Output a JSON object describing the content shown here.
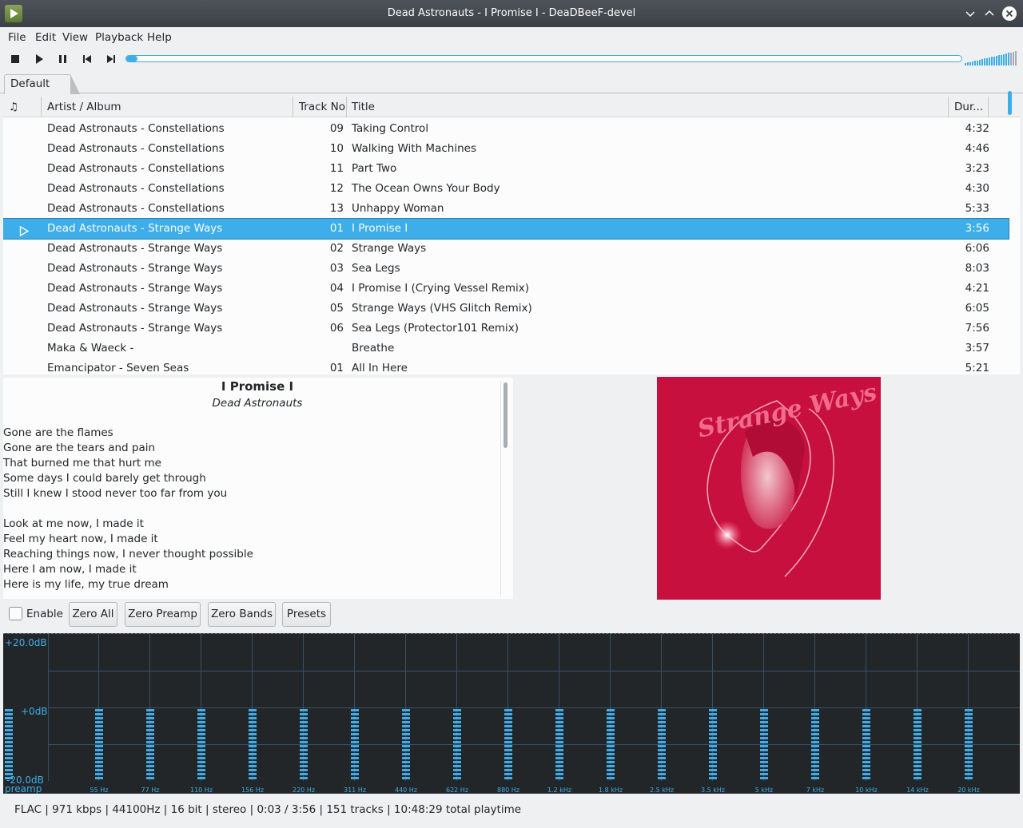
{
  "window": {
    "title": "Dead Astronauts - I Promise I - DeaDBeeF-devel"
  },
  "menu": [
    "File",
    "Edit",
    "View",
    "Playback",
    "Help"
  ],
  "toolbar": {
    "buttons": [
      "stop-icon",
      "play-icon",
      "pause-icon",
      "previous-icon",
      "next-icon"
    ],
    "seek_progress": 0.013,
    "volume_level": 0.85
  },
  "tabs": [
    "Default"
  ],
  "playlist": {
    "columns": [
      "♫",
      "Artist / Album",
      "Track No",
      "Title",
      "Dur..."
    ],
    "rows": [
      {
        "artist": "Dead Astronauts - Constellations",
        "no": "09",
        "title": "Taking Control",
        "dur": "4:32"
      },
      {
        "artist": "Dead Astronauts - Constellations",
        "no": "10",
        "title": "Walking With Machines",
        "dur": "4:46"
      },
      {
        "artist": "Dead Astronauts - Constellations",
        "no": "11",
        "title": "Part Two",
        "dur": "3:23"
      },
      {
        "artist": "Dead Astronauts - Constellations",
        "no": "12",
        "title": "The Ocean Owns Your Body",
        "dur": "4:30"
      },
      {
        "artist": "Dead Astronauts - Constellations",
        "no": "13",
        "title": "Unhappy Woman",
        "dur": "5:33"
      },
      {
        "artist": "Dead Astronauts - Strange Ways",
        "no": "01",
        "title": "I Promise I",
        "dur": "3:56",
        "playing": true
      },
      {
        "artist": "Dead Astronauts - Strange Ways",
        "no": "02",
        "title": "Strange Ways",
        "dur": "6:06"
      },
      {
        "artist": "Dead Astronauts - Strange Ways",
        "no": "03",
        "title": "Sea Legs",
        "dur": "8:03"
      },
      {
        "artist": "Dead Astronauts - Strange Ways",
        "no": "04",
        "title": "I Promise I (Crying Vessel Remix)",
        "dur": "4:21"
      },
      {
        "artist": "Dead Astronauts - Strange Ways",
        "no": "05",
        "title": "Strange Ways (VHS Glitch Remix)",
        "dur": "6:05"
      },
      {
        "artist": "Dead Astronauts - Strange Ways",
        "no": "06",
        "title": "Sea Legs (Protector101 Remix)",
        "dur": "7:56"
      },
      {
        "artist": "Maka & Waeck -",
        "no": "",
        "title": "Breathe",
        "dur": "3:57"
      },
      {
        "artist": "Emancipator - Seven Seas",
        "no": "01",
        "title": "All In Here",
        "dur": "5:21"
      }
    ]
  },
  "lyrics": {
    "title": "I Promise I",
    "artist": "Dead Astronauts",
    "lines": [
      "Gone are the flames",
      "Gone are the tears and pain",
      "That burned me that hurt me",
      "Some days I could barely get through",
      "Still I knew I stood never too far from you",
      "",
      "Look at me now, I made it",
      "Feel my heart now, I made it",
      "Reaching things now, I never thought possible",
      "Here I am now, I made it",
      "Here is my life, my true dream"
    ]
  },
  "album_art": {
    "cover_text": "Strange Ways",
    "background": "#c8103f"
  },
  "equalizer": {
    "enable_label": "Enable",
    "enabled": false,
    "buttons": [
      "Zero All",
      "Zero Preamp",
      "Zero Bands",
      "Presets"
    ],
    "db_labels": [
      "+20.0dB",
      "+0dB",
      "-20.0dB"
    ],
    "preamp_label": "preamp",
    "bands": [
      "55 Hz",
      "77 Hz",
      "110 Hz",
      "156 Hz",
      "220 Hz",
      "311 Hz",
      "440 Hz",
      "622 Hz",
      "880 Hz",
      "1.2 kHz",
      "1.8 kHz",
      "2.5 kHz",
      "3.5 kHz",
      "5 kHz",
      "7 kHz",
      "10 kHz",
      "14 kHz",
      "20 kHz"
    ],
    "band_gains_db": [
      0,
      0,
      0,
      0,
      0,
      0,
      0,
      0,
      0,
      0,
      0,
      0,
      0,
      0,
      0,
      0,
      0,
      0
    ],
    "preamp_db": 0
  },
  "status": {
    "text": "FLAC | 971 kbps | 44100Hz | 16 bit | stereo | 0:03 / 3:56 | 151 tracks | 10:48:29 total playtime"
  },
  "colors": {
    "accent": "#3daee9",
    "titlebar": "#475057",
    "window_bg": "#eff0f1",
    "eq_bg": "#232629"
  }
}
